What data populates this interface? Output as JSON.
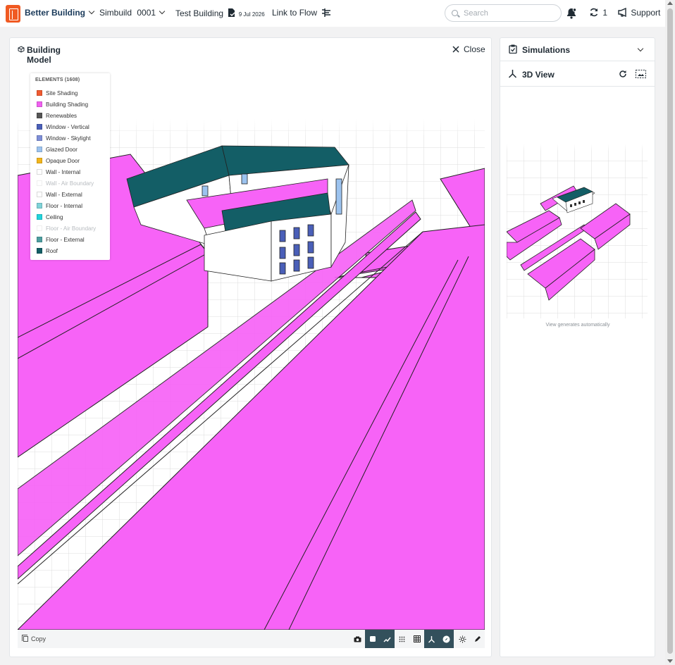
{
  "header": {
    "brand": "Better Building",
    "project": "Simbuild",
    "project_number": "0001",
    "building_name": "Test Building",
    "building_date": "9 Jul 2026",
    "link_to_flow": "Link to Flow",
    "search_placeholder": "Search",
    "sync_count": "1",
    "support": "Support"
  },
  "model_panel": {
    "title": "Building Model",
    "close_label": "Close",
    "legend": {
      "title": "ELEMENTS (1608)",
      "items": [
        {
          "label": "Site Shading",
          "color": "#f05a30",
          "dimmed": false
        },
        {
          "label": "Building Shading",
          "color": "#f060f0",
          "dimmed": false
        },
        {
          "label": "Renewables",
          "color": "#555555",
          "dimmed": false
        },
        {
          "label": "Window - Vertical",
          "color": "#4a5fb8",
          "dimmed": false
        },
        {
          "label": "Window - Skylight",
          "color": "#7e8fd8",
          "dimmed": false
        },
        {
          "label": "Glazed Door",
          "color": "#9cc3ef",
          "dimmed": false
        },
        {
          "label": "Opaque Door",
          "color": "#f2b51c",
          "dimmed": false
        },
        {
          "label": "Wall - Internal",
          "color": "#ffffff",
          "dimmed": false
        },
        {
          "label": "Wall - Air Boundary",
          "color": "#ffffff",
          "dimmed": true
        },
        {
          "label": "Wall - External",
          "color": "#ffffff",
          "dimmed": false
        },
        {
          "label": "Floor - Internal",
          "color": "#7fd3d8",
          "dimmed": false
        },
        {
          "label": "Ceiling",
          "color": "#22d4dc",
          "dimmed": false
        },
        {
          "label": "Floor - Air Boundary",
          "color": "#ffffff",
          "dimmed": true
        },
        {
          "label": "Floor - External",
          "color": "#4d9ea0",
          "dimmed": false
        },
        {
          "label": "Roof",
          "color": "#135e66",
          "dimmed": false
        }
      ]
    },
    "copy_label": "Copy",
    "tools": [
      "camera-icon",
      "cube-icon",
      "chart-icon",
      "dots-grid-icon",
      "table-grid-icon",
      "axes-icon",
      "compass-icon",
      "sun-icon",
      "pencil-icon"
    ]
  },
  "side_panel": {
    "simulations_title": "Simulations",
    "view_title": "3D View",
    "caption": "View generates automatically"
  },
  "colors": {
    "accent": "#f05a22",
    "shading": "#f763f7",
    "roof": "#135e66",
    "toolbar_dark": "#33505c"
  }
}
